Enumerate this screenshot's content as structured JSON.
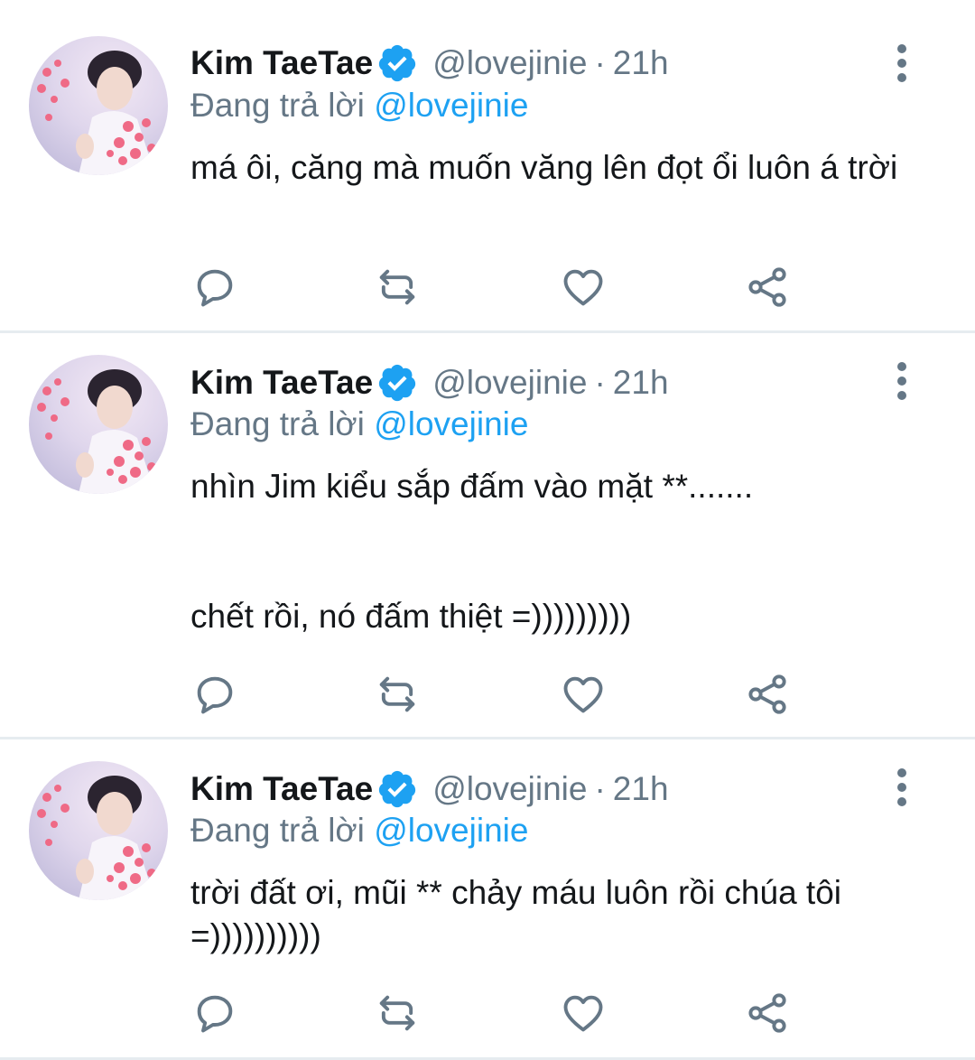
{
  "tweets": [
    {
      "author_name": "Kim TaeTae",
      "handle": "@lovejinie",
      "separator": "·",
      "time": "21h",
      "reply_prefix": "Đang trả lời",
      "reply_to": "@lovejinie",
      "text": "má ôi, căng mà muốn văng lên đọt ổi luôn á trời"
    },
    {
      "author_name": "Kim TaeTae",
      "handle": "@lovejinie",
      "separator": "·",
      "time": "21h",
      "reply_prefix": "Đang trả lời",
      "reply_to": "@lovejinie",
      "text_line1": "nhìn Jim kiểu sắp đấm vào mặt **.......",
      "text_line2": "chết rồi, nó đấm thiệt =)))))))))"
    },
    {
      "author_name": "Kim TaeTae",
      "handle": "@lovejinie",
      "separator": "·",
      "time": "21h",
      "reply_prefix": "Đang trả lời",
      "reply_to": "@lovejinie",
      "text": "trời đất ơi, mũi ** chảy máu luôn rồi chúa tôi =))))))))))"
    }
  ],
  "colors": {
    "primary_text": "#14171a",
    "secondary_text": "#657786",
    "link_blue": "#1da1f2",
    "icon_gray": "#657786",
    "divider": "#e6ecf0"
  },
  "icons": [
    "avatar-photo",
    "verified-badge-icon",
    "more-options-icon",
    "reply-icon",
    "retweet-icon",
    "like-icon",
    "share-icon"
  ]
}
